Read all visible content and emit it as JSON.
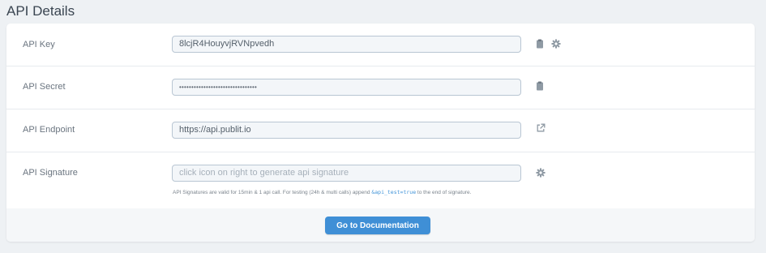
{
  "page": {
    "title": "API Details"
  },
  "api_key": {
    "label": "API Key",
    "value": "8lcjR4HouyvjRVNpvedh"
  },
  "api_secret": {
    "label": "API Secret",
    "value": "••••••••••••••••••••••••••••••••"
  },
  "api_endpoint": {
    "label": "API Endpoint",
    "value": "https://api.publit.io"
  },
  "api_signature": {
    "label": "API Signature",
    "placeholder": "click icon on right to generate api signature",
    "help_prefix": "API Signatures are valid for 15min & 1 api call. For testing (24h & multi calls) append ",
    "help_code": "&api_test=true",
    "help_suffix": " to the end of signature."
  },
  "footer": {
    "button_label": "Go to Documentation"
  },
  "icons": {
    "copy": "clipboard-icon",
    "settings": "gear-icon",
    "external": "external-link-icon"
  },
  "colors": {
    "accent": "#3f8fd6",
    "icon": "#8f9aa4",
    "code": "#3f93d8"
  }
}
